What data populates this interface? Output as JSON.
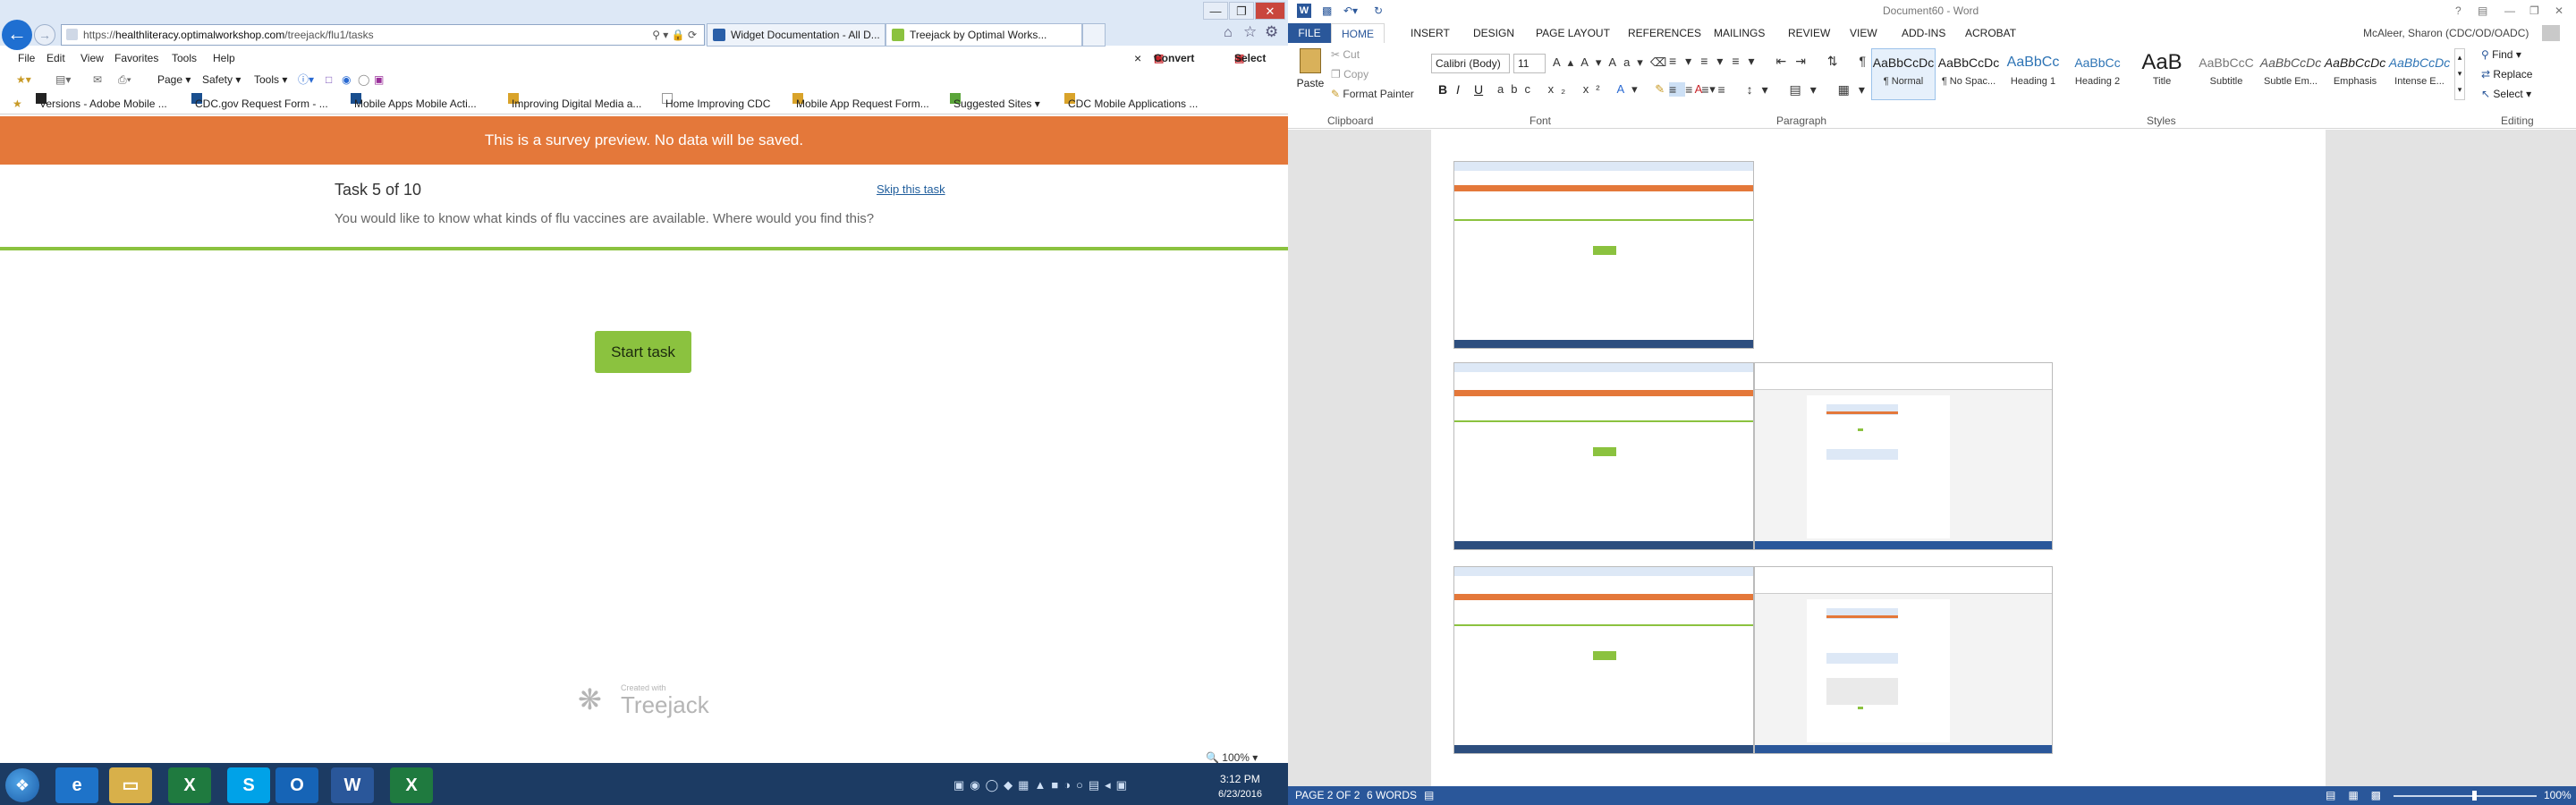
{
  "browser": {
    "url_prefix": "https://",
    "url_domain": "healthliteracy.optimalworkshop.com",
    "url_path": "/treejack/flu1/tasks",
    "search_glyph": "⚲ ▾ 🔒 ⟳",
    "tabs": [
      "Widget Documentation - All D...",
      "Treejack by Optimal Works..."
    ],
    "close_tab": "×",
    "window_controls": [
      "—",
      "❐",
      "✕"
    ],
    "menu": [
      "File",
      "Edit",
      "View",
      "Favorites",
      "Tools",
      "Help"
    ],
    "commands": [
      "Page ▾",
      "Safety ▾",
      "Tools ▾"
    ],
    "convert": "Convert",
    "select": "Select",
    "favorites": [
      "Versions - Adobe Mobile ...",
      "CDC.gov Request Form - ...",
      "Mobile Apps  Mobile Acti...",
      "Improving Digital Media a...",
      "Home  Improving CDC",
      "Mobile App Request Form...",
      "Suggested Sites ▾",
      "CDC Mobile Applications ..."
    ],
    "zoom": "🔍 100%  ▾"
  },
  "survey": {
    "banner": "This is a survey preview. No data will be saved.",
    "task_counter": "Task 5 of 10",
    "skip": "Skip this task",
    "question": "You would like to know what kinds of flu vaccines are available. Where would you find this?",
    "start": "Start task",
    "created_with": "Created with",
    "brand": "Treejack"
  },
  "taskbar": {
    "clock_time": "3:12 PM",
    "clock_date": "6/23/2016",
    "apps": [
      {
        "label": "e",
        "color": "#1e73c9"
      },
      {
        "label": "▭",
        "color": "#d8b04a"
      },
      {
        "label": "X",
        "color": "#1f7a3f"
      },
      {
        "label": "S",
        "color": "#00a2e8"
      },
      {
        "label": "O",
        "color": "#1664b6"
      },
      {
        "label": "W",
        "color": "#2a579a"
      },
      {
        "label": "X",
        "color": "#1f7a3f"
      }
    ]
  },
  "word": {
    "title": "Document60 - Word",
    "user": "McAleer, Sharon (CDC/OD/OADC)",
    "tabs": [
      "FILE",
      "HOME",
      "INSERT",
      "DESIGN",
      "PAGE LAYOUT",
      "REFERENCES",
      "MAILINGS",
      "REVIEW",
      "VIEW",
      "ADD-INS",
      "ACROBAT"
    ],
    "clipboard": {
      "paste": "Paste",
      "cut": "Cut",
      "copy": "Copy",
      "format_painter": "Format Painter"
    },
    "font_name": "Calibri (Body)",
    "font_size": "11",
    "font_buttons": [
      "B",
      "I",
      "U"
    ],
    "groups": [
      "Clipboard",
      "Font",
      "Paragraph",
      "Styles",
      "Editing"
    ],
    "styles": [
      {
        "preview": "AaBbCcDc",
        "name": "¶ Normal"
      },
      {
        "preview": "AaBbCcDc",
        "name": "¶ No Spac..."
      },
      {
        "preview": "AaBbCc",
        "name": "Heading 1"
      },
      {
        "preview": "AaBbCc",
        "name": "Heading 2"
      },
      {
        "preview": "AaB",
        "name": "Title"
      },
      {
        "preview": "AaBbCcC",
        "name": "Subtitle"
      },
      {
        "preview": "AaBbCcDc",
        "name": "Subtle Em..."
      },
      {
        "preview": "AaBbCcDc",
        "name": "Emphasis"
      },
      {
        "preview": "AaBbCcDc",
        "name": "Intense E..."
      }
    ],
    "editing": [
      "Find ▾",
      "Replace",
      "Select ▾"
    ],
    "status": {
      "page": "PAGE 2 OF 2",
      "words": "6 WORDS",
      "zoom": "100%"
    }
  },
  "colors": {
    "banner": "#e4783a",
    "accent_green": "#8bc23f",
    "word_blue": "#2a579a",
    "taskbar": "#1c3b63"
  }
}
